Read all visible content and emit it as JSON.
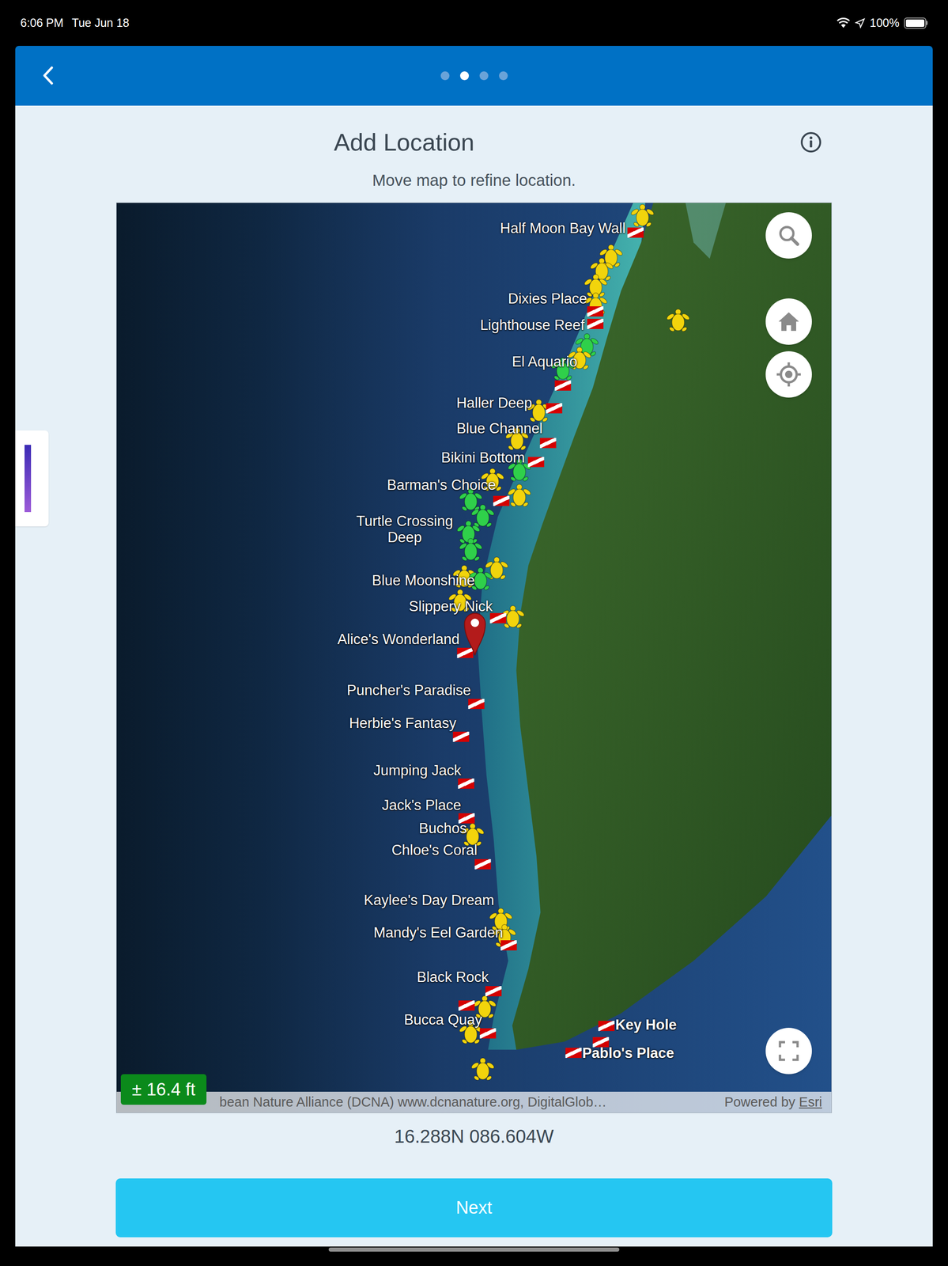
{
  "status_bar": {
    "time": "6:06 PM",
    "date": "Tue Jun 18",
    "battery": "100%",
    "battery_level": 1
  },
  "header": {
    "pages": [
      {
        "selected": false
      },
      {
        "selected": true
      },
      {
        "selected": false
      },
      {
        "selected": false
      }
    ]
  },
  "title": "Add Location",
  "subtitle": "Move map to refine location.",
  "map": {
    "sites": [
      {
        "label": "Half Moon Bay Wall",
        "kind": "center"
      },
      {
        "label": "Dixies Place",
        "kind": "left"
      },
      {
        "label": "Lighthouse Reef",
        "kind": "left"
      },
      {
        "label": "El Aquario",
        "kind": "left"
      },
      {
        "label": "Haller Deep",
        "kind": "left"
      },
      {
        "label": "Blue Channel",
        "kind": "left"
      },
      {
        "label": "Bikini Bottom",
        "kind": "left"
      },
      {
        "label": "Barman's Choice",
        "kind": "left"
      },
      {
        "label": "Turtle Crossing Deep",
        "kind": "center"
      },
      {
        "label": "Blue Moonshine",
        "kind": "left"
      },
      {
        "label": "Slippery Nick",
        "kind": "left"
      },
      {
        "label": "Alice's Wonderland",
        "kind": "left"
      },
      {
        "label": "Puncher's Paradise",
        "kind": "left"
      },
      {
        "label": "Herbie's Fantasy",
        "kind": "left"
      },
      {
        "label": "Jumping Jack",
        "kind": "left"
      },
      {
        "label": "Jack's Place",
        "kind": "left"
      },
      {
        "label": "Buchos",
        "kind": "left"
      },
      {
        "label": "Chloe's Coral",
        "kind": "left"
      },
      {
        "label": "Kaylee's Day Dream",
        "kind": "left"
      },
      {
        "label": "Mandy's Eel Garden",
        "kind": "left"
      },
      {
        "label": "Black Rock",
        "kind": "left"
      },
      {
        "label": "Bucca Quay",
        "kind": "left"
      },
      {
        "label": "Key Hole",
        "kind": "right"
      },
      {
        "label": "Pablo's Place",
        "kind": "right"
      }
    ],
    "turtles": [
      {
        "color": "#f2d40c"
      },
      {
        "color": "#f2d40c"
      },
      {
        "color": "#f2d40c"
      },
      {
        "color": "#f2d40c"
      },
      {
        "color": "#f2d40c"
      },
      {
        "color": "#f2d40c"
      },
      {
        "color": "#2fd04a"
      },
      {
        "color": "#f2d40c"
      },
      {
        "color": "#2fd04a"
      },
      {
        "color": "#f2d40c"
      },
      {
        "color": "#f2d40c"
      },
      {
        "color": "#2fd04a"
      },
      {
        "color": "#f2d40c"
      },
      {
        "color": "#f2d40c"
      },
      {
        "color": "#2fd04a"
      },
      {
        "color": "#2fd04a"
      },
      {
        "color": "#2fd04a"
      },
      {
        "color": "#2fd04a"
      },
      {
        "color": "#f2d40c"
      },
      {
        "color": "#f2d40c"
      },
      {
        "color": "#2fd04a"
      },
      {
        "color": "#f2d40c"
      },
      {
        "color": "#f2d40c"
      },
      {
        "color": "#f2d40c"
      },
      {
        "color": "#f2d40c"
      },
      {
        "color": "#f2d40c"
      },
      {
        "color": "#f2d40c"
      },
      {
        "color": "#f2d40c"
      },
      {
        "color": "#f2d40c"
      }
    ],
    "accuracy": "± 16.4 ft",
    "attribution": "bean Nature Alliance (DCNA) www.dcnanature.org, DigitalGlob…",
    "powered_by": "Powered by",
    "powered_link": "Esri"
  },
  "coordinates": "16.288N 086.604W",
  "buttons": [
    "Next"
  ]
}
